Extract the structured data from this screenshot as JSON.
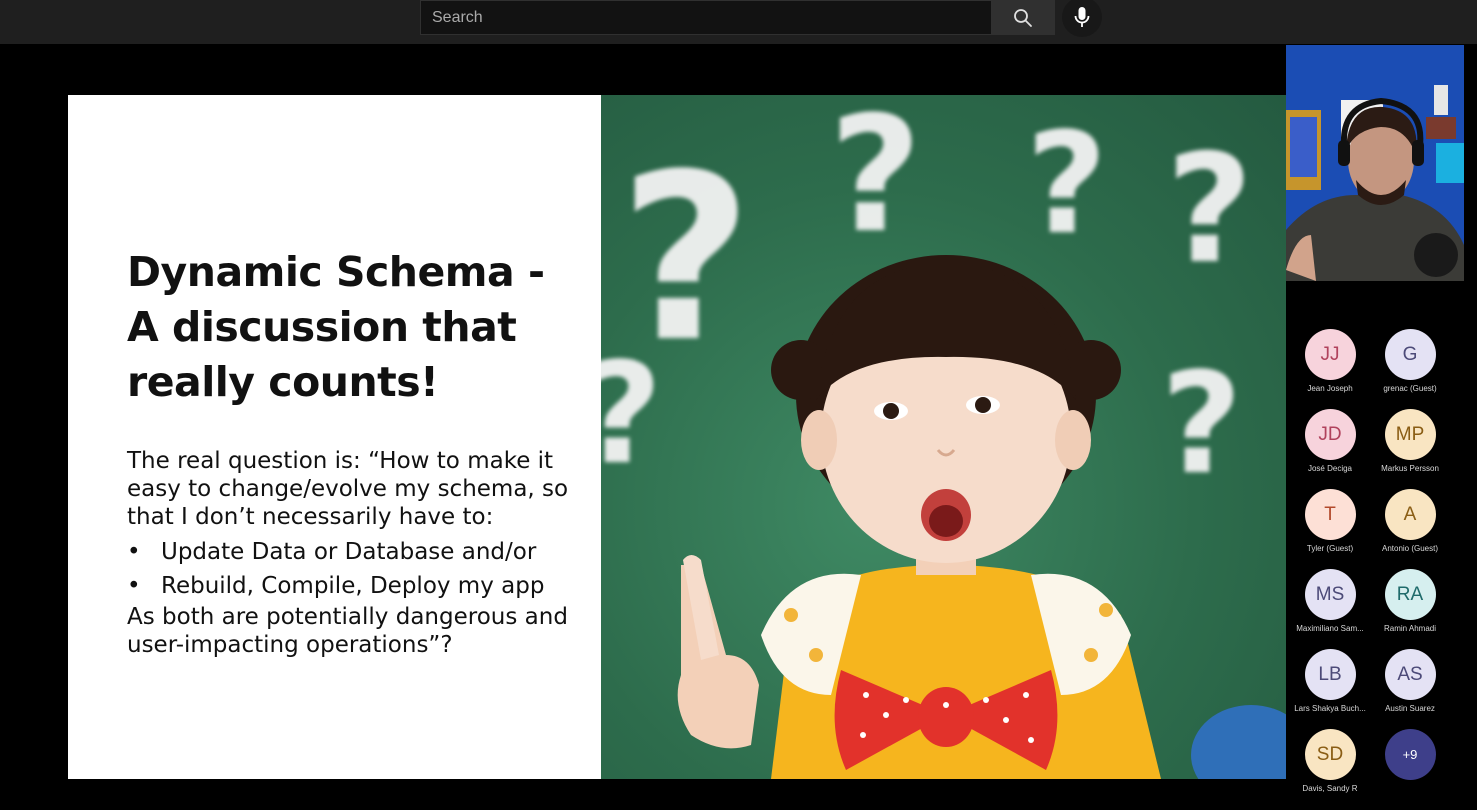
{
  "search": {
    "placeholder": "Search"
  },
  "icons": {
    "search": "search-icon",
    "mic": "microphone-icon"
  },
  "slide": {
    "title_lines": [
      "Dynamic Schema -",
      "A discussion that",
      "really counts!"
    ],
    "body_intro": "The real question is: “How to make it easy to change/evolve my schema, so that I don’t necessarily have to:",
    "bullets": [
      "Update Data or Database and/or",
      "Rebuild, Compile, Deploy my app"
    ],
    "body_outro": "As both are potentially dangerous and user-impacting operations”?"
  },
  "participants": [
    {
      "initials": "JJ",
      "name": "Jean Joseph",
      "bg": "#f7d3dc",
      "fg": "#b0425c"
    },
    {
      "initials": "G",
      "name": "grenac (Guest)",
      "bg": "#e4e2f4",
      "fg": "#4c4a78"
    },
    {
      "initials": "JD",
      "name": "José Deciga",
      "bg": "#f7d3dc",
      "fg": "#b0425c"
    },
    {
      "initials": "MP",
      "name": "Markus Persson",
      "bg": "#f9e5c2",
      "fg": "#8a5d14"
    },
    {
      "initials": "T",
      "name": "Tyler (Guest)",
      "bg": "#fde0d6",
      "fg": "#b24a2c"
    },
    {
      "initials": "A",
      "name": "Antonio (Guest)",
      "bg": "#f9e5c2",
      "fg": "#8a5d14"
    },
    {
      "initials": "MS",
      "name": "Maximiliano Sam...",
      "bg": "#e4e2f4",
      "fg": "#4c4a78"
    },
    {
      "initials": "RA",
      "name": "Ramin Ahmadi",
      "bg": "#d6efef",
      "fg": "#1f6b6b"
    },
    {
      "initials": "LB",
      "name": "Lars Shakya Buch...",
      "bg": "#e4e2f4",
      "fg": "#4c4a78"
    },
    {
      "initials": "AS",
      "name": "Austin Suarez",
      "bg": "#e4e2f4",
      "fg": "#4c4a78"
    },
    {
      "initials": "SD",
      "name": "Davis, Sandy R",
      "bg": "#f9e5c2",
      "fg": "#8a5d14"
    },
    {
      "initials": "+9",
      "name": "",
      "bg": "#3e3f8a",
      "fg": "#ffffff"
    }
  ]
}
